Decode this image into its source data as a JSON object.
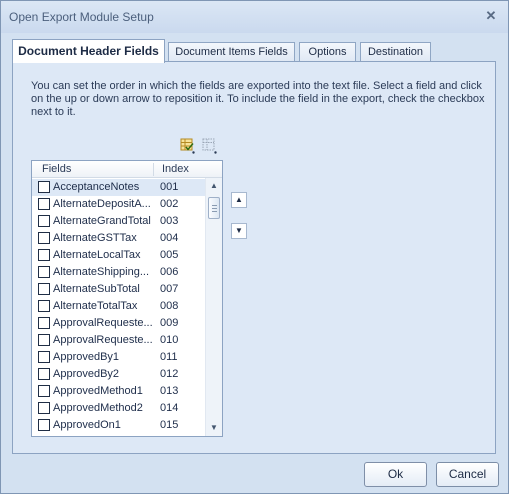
{
  "window": {
    "title": "Open Export Module Setup"
  },
  "tabs": [
    {
      "label": "Document Header Fields",
      "active": true
    },
    {
      "label": "Document Items Fields",
      "active": false
    },
    {
      "label": "Options",
      "active": false
    },
    {
      "label": "Destination",
      "active": false
    }
  ],
  "help_text": "You can set the order in which the fields are exported into the text file.  Select a field and click on the up or down arrow to reposition it.  To include the field in the export, check the checkbox next to it.",
  "toolbar": {
    "check_all_icon": "check-all-icon",
    "uncheck_all_icon": "uncheck-all-icon"
  },
  "list": {
    "headers": {
      "fields": "Fields",
      "index": "Index"
    },
    "rows": [
      {
        "name": "AcceptanceNotes",
        "index": "001",
        "checked": false,
        "selected": true
      },
      {
        "name": "AlternateDepositA...",
        "index": "002",
        "checked": false
      },
      {
        "name": "AlternateGrandTotal",
        "index": "003",
        "checked": false
      },
      {
        "name": "AlternateGSTTax",
        "index": "004",
        "checked": false
      },
      {
        "name": "AlternateLocalTax",
        "index": "005",
        "checked": false
      },
      {
        "name": "AlternateShipping...",
        "index": "006",
        "checked": false
      },
      {
        "name": "AlternateSubTotal",
        "index": "007",
        "checked": false
      },
      {
        "name": "AlternateTotalTax",
        "index": "008",
        "checked": false
      },
      {
        "name": "ApprovalRequeste...",
        "index": "009",
        "checked": false
      },
      {
        "name": "ApprovalRequeste...",
        "index": "010",
        "checked": false
      },
      {
        "name": "ApprovedBy1",
        "index": "011",
        "checked": false
      },
      {
        "name": "ApprovedBy2",
        "index": "012",
        "checked": false
      },
      {
        "name": "ApprovedMethod1",
        "index": "013",
        "checked": false
      },
      {
        "name": "ApprovedMethod2",
        "index": "014",
        "checked": false
      },
      {
        "name": "ApprovedOn1",
        "index": "015",
        "checked": false
      },
      {
        "name": "",
        "index": "",
        "checked": false
      }
    ]
  },
  "buttons": {
    "ok": "Ok",
    "cancel": "Cancel"
  },
  "colors": {
    "window_bg": "#d3e1f1",
    "tab_page_bg": "#dde8f6",
    "border": "#8ca3c2",
    "text": "#1e2d4a"
  }
}
